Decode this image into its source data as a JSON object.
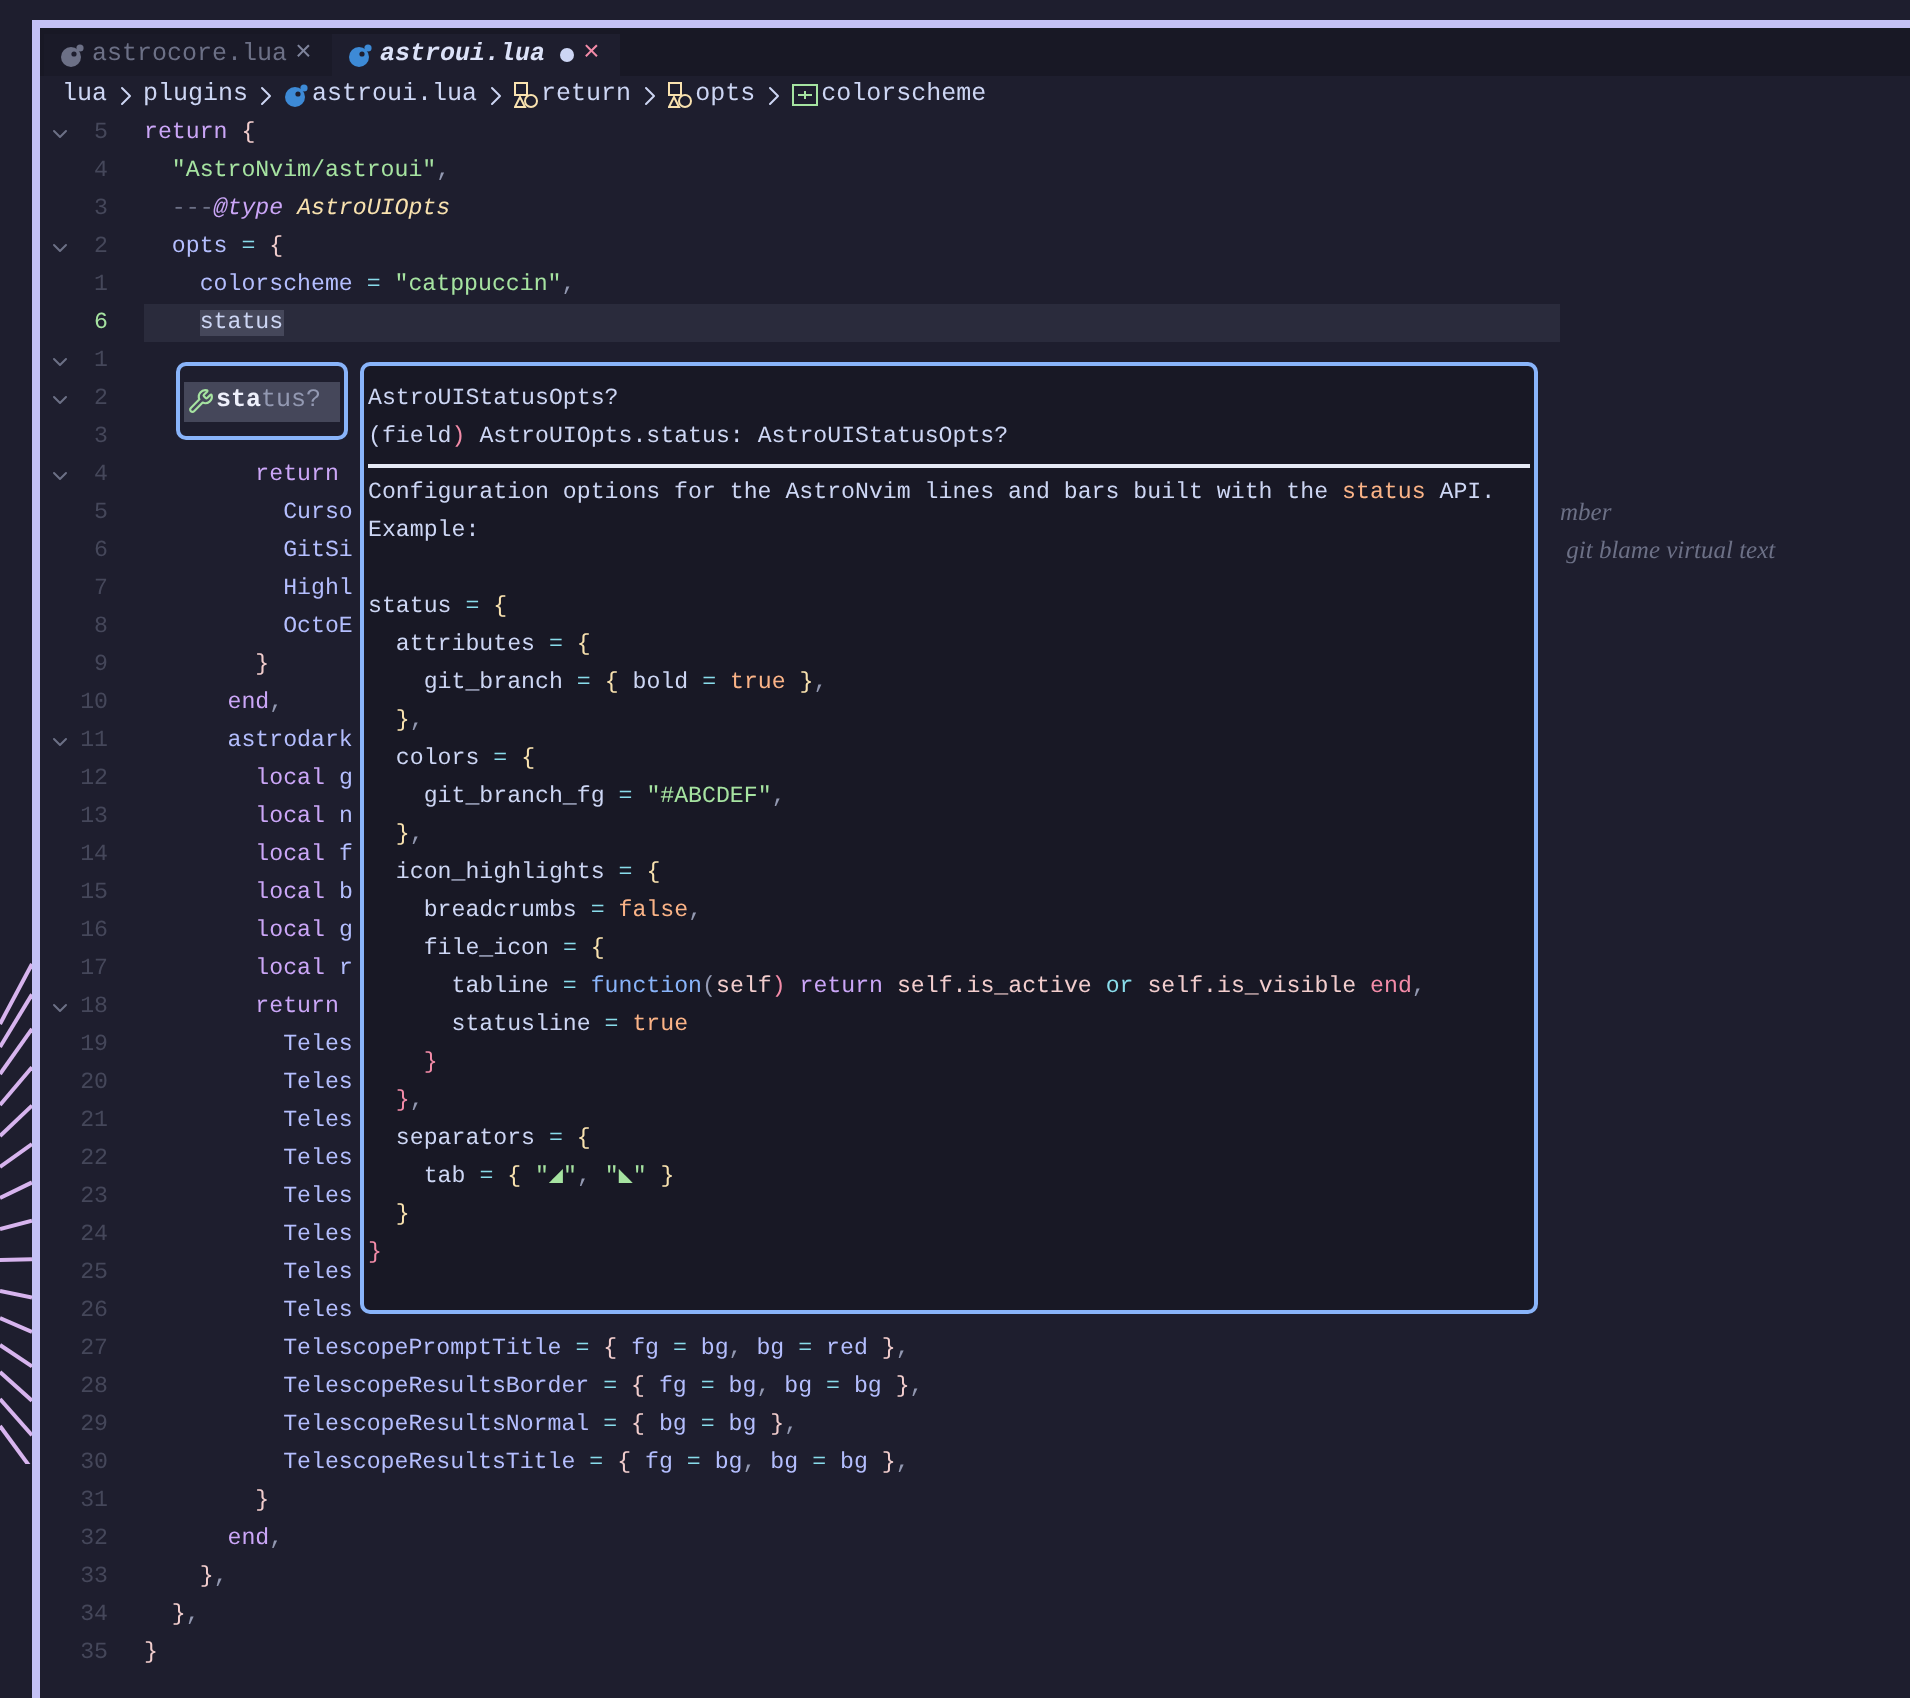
{
  "tabs": [
    {
      "label": "astrocore.lua",
      "selected": false,
      "modified": false,
      "close": "×"
    },
    {
      "label": "astroui.lua",
      "selected": true,
      "modified": true,
      "close": "×"
    }
  ],
  "breadcrumbs": [
    {
      "label": "lua",
      "kind": "folder"
    },
    {
      "label": "plugins",
      "kind": "folder"
    },
    {
      "label": "astroui.lua",
      "kind": "file"
    },
    {
      "label": "return",
      "kind": "object"
    },
    {
      "label": "opts",
      "kind": "object"
    },
    {
      "label": "colorscheme",
      "kind": "field"
    }
  ],
  "lines": [
    {
      "number": "5",
      "foldable": true,
      "current": false,
      "tokens": [
        {
          "text": "return",
          "kind": "keyword"
        },
        {
          "text": " {",
          "kind": "brace"
        }
      ]
    },
    {
      "number": "4",
      "foldable": false,
      "current": false,
      "tokens": [
        {
          "text": "  \"AstroNvim/astroui\"",
          "kind": "string"
        },
        {
          "text": ",",
          "kind": "punct"
        }
      ]
    },
    {
      "number": "3",
      "foldable": false,
      "current": false,
      "tokens": [
        {
          "text": "  ---",
          "kind": "comment"
        },
        {
          "text": "@type",
          "kind": "decorator"
        },
        {
          "text": " AstroUIOpts",
          "kind": "type"
        }
      ]
    },
    {
      "number": "2",
      "foldable": true,
      "current": false,
      "tokens": [
        {
          "text": "  opts",
          "kind": "field"
        },
        {
          "text": " = ",
          "kind": "operator"
        },
        {
          "text": "{",
          "kind": "brace"
        }
      ]
    },
    {
      "number": "1",
      "foldable": false,
      "current": false,
      "tokens": [
        {
          "text": "    colorscheme",
          "kind": "field"
        },
        {
          "text": " = ",
          "kind": "operator"
        },
        {
          "text": "\"catppuccin\"",
          "kind": "string"
        },
        {
          "text": ",",
          "kind": "punct"
        }
      ]
    },
    {
      "number": "6",
      "foldable": false,
      "current": true,
      "tokens": [
        {
          "text": "    status",
          "kind": "selected_word"
        }
      ]
    },
    {
      "number": "1",
      "foldable": true,
      "current": false
    },
    {
      "number": "2",
      "foldable": true,
      "current": false
    },
    {
      "number": "3",
      "foldable": false,
      "current": false
    },
    {
      "number": "4",
      "foldable": true,
      "current": false,
      "tokens": [
        {
          "text": "        return",
          "kind": "keyword"
        }
      ]
    },
    {
      "number": "5",
      "foldable": false,
      "current": false,
      "tokens": [
        {
          "text": "          Curso",
          "kind": "field"
        }
      ],
      "virtual_text": "mber"
    },
    {
      "number": "6",
      "foldable": false,
      "current": false,
      "tokens": [
        {
          "text": "          GitSi",
          "kind": "field"
        }
      ],
      "virtual_text": " git blame virtual text"
    },
    {
      "number": "7",
      "foldable": false,
      "current": false,
      "tokens": [
        {
          "text": "          Highl",
          "kind": "field"
        }
      ]
    },
    {
      "number": "8",
      "foldable": false,
      "current": false,
      "tokens": [
        {
          "text": "          OctoE",
          "kind": "field"
        }
      ]
    },
    {
      "number": "9",
      "foldable": false,
      "current": false,
      "tokens": [
        {
          "text": "        }",
          "kind": "brace"
        }
      ]
    },
    {
      "number": "10",
      "foldable": false,
      "current": false,
      "tokens": [
        {
          "text": "      end",
          "kind": "keyword"
        },
        {
          "text": ",",
          "kind": "punct"
        }
      ]
    },
    {
      "number": "11",
      "foldable": true,
      "current": false,
      "tokens": [
        {
          "text": "      astrodark",
          "kind": "field"
        }
      ]
    },
    {
      "number": "12",
      "foldable": false,
      "current": false,
      "tokens": [
        {
          "text": "        local",
          "kind": "keyword"
        },
        {
          "text": " g",
          "kind": "field"
        }
      ]
    },
    {
      "number": "13",
      "foldable": false,
      "current": false,
      "tokens": [
        {
          "text": "        local",
          "kind": "keyword"
        },
        {
          "text": " n",
          "kind": "field"
        }
      ]
    },
    {
      "number": "14",
      "foldable": false,
      "current": false,
      "tokens": [
        {
          "text": "        local",
          "kind": "keyword"
        },
        {
          "text": " f",
          "kind": "field"
        }
      ]
    },
    {
      "number": "15",
      "foldable": false,
      "current": false,
      "tokens": [
        {
          "text": "        local",
          "kind": "keyword"
        },
        {
          "text": " b",
          "kind": "field"
        }
      ]
    },
    {
      "number": "16",
      "foldable": false,
      "current": false,
      "tokens": [
        {
          "text": "        local",
          "kind": "keyword"
        },
        {
          "text": " g",
          "kind": "field"
        }
      ]
    },
    {
      "number": "17",
      "foldable": false,
      "current": false,
      "tokens": [
        {
          "text": "        local",
          "kind": "keyword"
        },
        {
          "text": " r",
          "kind": "field"
        }
      ]
    },
    {
      "number": "18",
      "foldable": true,
      "current": false,
      "tokens": [
        {
          "text": "        return",
          "kind": "keyword"
        }
      ]
    },
    {
      "number": "19",
      "foldable": false,
      "current": false,
      "tokens": [
        {
          "text": "          Teles",
          "kind": "field"
        }
      ]
    },
    {
      "number": "20",
      "foldable": false,
      "current": false,
      "tokens": [
        {
          "text": "          Teles",
          "kind": "field"
        }
      ]
    },
    {
      "number": "21",
      "foldable": false,
      "current": false,
      "tokens": [
        {
          "text": "          Teles",
          "kind": "field"
        }
      ]
    },
    {
      "number": "22",
      "foldable": false,
      "current": false,
      "tokens": [
        {
          "text": "          Teles",
          "kind": "field"
        }
      ]
    },
    {
      "number": "23",
      "foldable": false,
      "current": false,
      "tokens": [
        {
          "text": "          Teles",
          "kind": "field"
        }
      ]
    },
    {
      "number": "24",
      "foldable": false,
      "current": false,
      "tokens": [
        {
          "text": "          Teles",
          "kind": "field"
        }
      ]
    },
    {
      "number": "25",
      "foldable": false,
      "current": false,
      "tokens": [
        {
          "text": "          Teles",
          "kind": "field"
        }
      ]
    },
    {
      "number": "26",
      "foldable": false,
      "current": false,
      "tokens": [
        {
          "text": "          Teles",
          "kind": "field"
        }
      ]
    },
    {
      "number": "27",
      "foldable": false,
      "current": false,
      "tokens": [
        {
          "text": "          TelescopePromptTitle",
          "kind": "field"
        },
        {
          "text": " = ",
          "kind": "operator"
        },
        {
          "text": "{",
          "kind": "brace"
        },
        {
          "text": " fg",
          "kind": "field"
        },
        {
          "text": " = ",
          "kind": "operator"
        },
        {
          "text": "bg",
          "kind": "field"
        },
        {
          "text": ", ",
          "kind": "punct"
        },
        {
          "text": "bg",
          "kind": "field"
        },
        {
          "text": " = ",
          "kind": "operator"
        },
        {
          "text": "red ",
          "kind": "field"
        },
        {
          "text": "}",
          "kind": "brace"
        },
        {
          "text": ",",
          "kind": "punct"
        }
      ]
    },
    {
      "number": "28",
      "foldable": false,
      "current": false,
      "tokens": [
        {
          "text": "          TelescopeResultsBorder",
          "kind": "field"
        },
        {
          "text": " = ",
          "kind": "operator"
        },
        {
          "text": "{",
          "kind": "brace"
        },
        {
          "text": " fg",
          "kind": "field"
        },
        {
          "text": " = ",
          "kind": "operator"
        },
        {
          "text": "bg",
          "kind": "field"
        },
        {
          "text": ", ",
          "kind": "punct"
        },
        {
          "text": "bg",
          "kind": "field"
        },
        {
          "text": " = ",
          "kind": "operator"
        },
        {
          "text": "bg ",
          "kind": "field"
        },
        {
          "text": "}",
          "kind": "brace"
        },
        {
          "text": ",",
          "kind": "punct"
        }
      ]
    },
    {
      "number": "29",
      "foldable": false,
      "current": false,
      "tokens": [
        {
          "text": "          TelescopeResultsNormal",
          "kind": "field"
        },
        {
          "text": " = ",
          "kind": "operator"
        },
        {
          "text": "{",
          "kind": "brace"
        },
        {
          "text": " bg",
          "kind": "field"
        },
        {
          "text": " = ",
          "kind": "operator"
        },
        {
          "text": "bg ",
          "kind": "field"
        },
        {
          "text": "}",
          "kind": "brace"
        },
        {
          "text": ",",
          "kind": "punct"
        }
      ]
    },
    {
      "number": "30",
      "foldable": false,
      "current": false,
      "tokens": [
        {
          "text": "          TelescopeResultsTitle",
          "kind": "field"
        },
        {
          "text": " = ",
          "kind": "operator"
        },
        {
          "text": "{",
          "kind": "brace"
        },
        {
          "text": " fg",
          "kind": "field"
        },
        {
          "text": " = ",
          "kind": "operator"
        },
        {
          "text": "bg",
          "kind": "field"
        },
        {
          "text": ", ",
          "kind": "punct"
        },
        {
          "text": "bg",
          "kind": "field"
        },
        {
          "text": " = ",
          "kind": "operator"
        },
        {
          "text": "bg ",
          "kind": "field"
        },
        {
          "text": "}",
          "kind": "brace"
        },
        {
          "text": ",",
          "kind": "punct"
        }
      ]
    },
    {
      "number": "31",
      "foldable": false,
      "current": false,
      "tokens": [
        {
          "text": "        }",
          "kind": "brace"
        }
      ]
    },
    {
      "number": "32",
      "foldable": false,
      "current": false,
      "tokens": [
        {
          "text": "      end",
          "kind": "keyword"
        },
        {
          "text": ",",
          "kind": "punct"
        }
      ]
    },
    {
      "number": "33",
      "foldable": false,
      "current": false,
      "tokens": [
        {
          "text": "    }",
          "kind": "brace"
        },
        {
          "text": ",",
          "kind": "punct"
        }
      ]
    },
    {
      "number": "34",
      "foldable": false,
      "current": false,
      "tokens": [
        {
          "text": "  }",
          "kind": "brace"
        },
        {
          "text": ",",
          "kind": "punct"
        }
      ]
    },
    {
      "number": "35",
      "foldable": false,
      "current": false,
      "tokens": [
        {
          "text": "}",
          "kind": "brace"
        }
      ]
    }
  ],
  "completion": {
    "items": [
      {
        "label": "**sta**tus?",
        "selected": true
      }
    ]
  },
  "hover": {
    "header": [
      [
        {
          "text": "AstroUIStatusOpts?",
          "kind": "text"
        }
      ],
      [
        {
          "text": "(field",
          "kind": "text"
        },
        {
          "text": ")",
          "kind": "bracket_red"
        },
        {
          "text": " AstroUIOpts.status: AstroUIStatusOpts?",
          "kind": "text"
        }
      ]
    ],
    "description": [
      [
        {
          "text": "Configuration options for the AstroNvim lines and bars built with the ",
          "kind": "text"
        },
        {
          "text": "status",
          "kind": "reference"
        },
        {
          "text": " API.",
          "kind": "text"
        }
      ],
      [
        {
          "text": "Example:",
          "kind": "text"
        }
      ]
    ],
    "example": [
      [
        {
          "text": "status",
          "kind": "text"
        },
        {
          "text": " = ",
          "kind": "operator"
        },
        {
          "text": "{",
          "kind": "bracket_yellow"
        }
      ],
      [
        {
          "text": "  attributes",
          "kind": "text"
        },
        {
          "text": " = ",
          "kind": "operator"
        },
        {
          "text": "{",
          "kind": "bracket_yellow"
        }
      ],
      [
        {
          "text": "    git_branch",
          "kind": "text"
        },
        {
          "text": " = ",
          "kind": "operator"
        },
        {
          "text": "{",
          "kind": "bracket_yellow"
        },
        {
          "text": " bold",
          "kind": "text"
        },
        {
          "text": " = ",
          "kind": "operator"
        },
        {
          "text": "true ",
          "kind": "boolean"
        },
        {
          "text": "}",
          "kind": "bracket_yellow"
        },
        {
          "text": ",",
          "kind": "punct"
        }
      ],
      [
        {
          "text": "  }",
          "kind": "bracket_yellow"
        },
        {
          "text": ",",
          "kind": "punct"
        }
      ],
      [
        {
          "text": "  colors",
          "kind": "text"
        },
        {
          "text": " = ",
          "kind": "operator"
        },
        {
          "text": "{",
          "kind": "bracket_yellow"
        }
      ],
      [
        {
          "text": "    git_branch_fg",
          "kind": "text"
        },
        {
          "text": " = ",
          "kind": "operator"
        },
        {
          "text": "\"#ABCDEF\"",
          "kind": "string"
        },
        {
          "text": ",",
          "kind": "punct"
        }
      ],
      [
        {
          "text": "  }",
          "kind": "bracket_yellow"
        },
        {
          "text": ",",
          "kind": "punct"
        }
      ],
      [
        {
          "text": "  icon_highlights",
          "kind": "text"
        },
        {
          "text": " = ",
          "kind": "operator"
        },
        {
          "text": "{",
          "kind": "bracket_yellow"
        }
      ],
      [
        {
          "text": "    breadcrumbs",
          "kind": "text"
        },
        {
          "text": " = ",
          "kind": "operator"
        },
        {
          "text": "false",
          "kind": "boolean"
        },
        {
          "text": ",",
          "kind": "punct"
        }
      ],
      [
        {
          "text": "    file_icon",
          "kind": "text"
        },
        {
          "text": " = ",
          "kind": "operator"
        },
        {
          "text": "{",
          "kind": "bracket_yellow"
        }
      ],
      [
        {
          "text": "      tabline",
          "kind": "text"
        },
        {
          "text": " = ",
          "kind": "operator"
        },
        {
          "text": "function",
          "kind": "func"
        },
        {
          "text": "(",
          "kind": "punct"
        },
        {
          "text": "self",
          "kind": "param"
        },
        {
          "text": ") ",
          "kind": "bracket_red"
        },
        {
          "text": "return ",
          "kind": "keyword"
        },
        {
          "text": "self.is_active ",
          "kind": "param"
        },
        {
          "text": "or ",
          "kind": "operator"
        },
        {
          "text": "self.is_visible ",
          "kind": "param"
        },
        {
          "text": "end",
          "kind": "keyword_end"
        },
        {
          "text": ",",
          "kind": "punct"
        }
      ],
      [
        {
          "text": "      statusline",
          "kind": "text"
        },
        {
          "text": " = ",
          "kind": "operator"
        },
        {
          "text": "true",
          "kind": "boolean"
        }
      ],
      [
        {
          "text": "    }",
          "kind": "bracket_red"
        }
      ],
      [
        {
          "text": "  }",
          "kind": "bracket_red"
        },
        {
          "text": ",",
          "kind": "punct"
        }
      ],
      [
        {
          "text": "  separators",
          "kind": "text"
        },
        {
          "text": " = ",
          "kind": "operator"
        },
        {
          "text": "{",
          "kind": "bracket_yellow"
        }
      ],
      [
        {
          "text": "    tab",
          "kind": "text"
        },
        {
          "text": " = ",
          "kind": "operator"
        },
        {
          "text": "{ ",
          "kind": "bracket_yellow"
        },
        {
          "text": "\"",
          "kind": "string"
        },
        {
          "text": "◢",
          "kind": "glyph"
        },
        {
          "text": "\"",
          "kind": "string"
        },
        {
          "text": ", ",
          "kind": "punct"
        },
        {
          "text": "\"",
          "kind": "string"
        },
        {
          "text": "◣",
          "kind": "glyph"
        },
        {
          "text": "\"",
          "kind": "string"
        },
        {
          "text": " }",
          "kind": "bracket_yellow"
        }
      ],
      [
        {
          "text": "  }",
          "kind": "bracket_yellow"
        }
      ],
      [
        {
          "text": "}",
          "kind": "bracket_red"
        }
      ]
    ]
  }
}
